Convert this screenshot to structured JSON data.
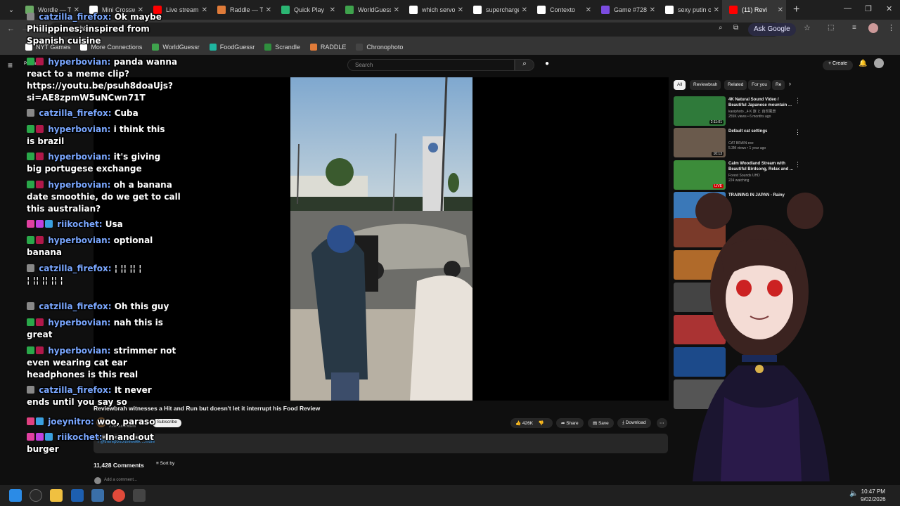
{
  "browser": {
    "tabs": [
      {
        "title": "Wordle — Th",
        "color": "#6aaa64"
      },
      {
        "title": "Mini Crossw",
        "color": "#ffffff"
      },
      {
        "title": "Live stream",
        "color": "#ff0000"
      },
      {
        "title": "Raddle — Th",
        "color": "#e07b39"
      },
      {
        "title": "Quick Play",
        "color": "#2bb673"
      },
      {
        "title": "WorldGuess",
        "color": "#3fa34d"
      },
      {
        "title": "which servo",
        "color": "#ffffff"
      },
      {
        "title": "supercharge",
        "color": "#ffffff"
      },
      {
        "title": "Contexto",
        "color": "#ffffff"
      },
      {
        "title": "Game #728",
        "color": "#7b4ce0"
      },
      {
        "title": "sexy putin c",
        "color": "#ffffff"
      },
      {
        "title": "(11) Revi",
        "color": "#ff0000"
      }
    ],
    "url": "/v=psuh8doaUjs",
    "ask_google": "Ask Google",
    "bookmarks": [
      {
        "label": "NYT Games",
        "color": "#ffffff"
      },
      {
        "label": "More Connections",
        "color": "#ffffff"
      },
      {
        "label": "WorldGuessr",
        "color": "#3fa34d"
      },
      {
        "label": "FoodGuessr",
        "color": "#1fb5a0"
      },
      {
        "label": "Scrandle",
        "color": "#2f8f3e"
      },
      {
        "label": "RADDLE",
        "color": "#e07b39"
      },
      {
        "label": "Chronophoto",
        "color": "#444444"
      }
    ]
  },
  "youtube": {
    "search_placeholder": "Search",
    "create_label": "Create",
    "premium_label": "Premium",
    "video_title": "Reviewbrah witnesses a Hit and Run but doesn't let it interrupt his Food Review",
    "channel_subs": "2.2M subscribers",
    "subscribe_label": "Subscribe",
    "likes": "426K",
    "share_label": "Share",
    "save_label": "Save",
    "download_label": "Download",
    "views_line": "11M views  8 years ago",
    "desc_line": "/ @thereportoftheweek  ...more",
    "comments_count": "11,428 Comments",
    "sort_label": "Sort by",
    "add_comment": "Add a comment...",
    "chips": [
      "All",
      "Reviewbrah",
      "Related",
      "For you",
      "Re"
    ],
    "recommendations": [
      {
        "title": "4K Natural Sound Video / Beautiful Japanese mountain ...",
        "channel": "kaoiphoto _4 K 旅 と 自然風景",
        "meta": "255K views • 6 months ago",
        "duration": "2:11:01",
        "color": "#2f7a3a"
      },
      {
        "title": "Default cat settings",
        "channel": "CAT BRAIN exe",
        "meta": "5.3M views • 1 year ago",
        "duration": "10:13",
        "color": "#6a5a4c"
      },
      {
        "title": "Calm Woodland Stream with Beautiful Birdsong, Relax and ...",
        "channel": "Forest Sounds UHD",
        "meta": "224 watching",
        "duration": "LIVE",
        "color": "#3c8c3a"
      },
      {
        "title": "TRAINING IN JAPAN - Rainy",
        "channel": "",
        "meta": "",
        "duration": "",
        "color": "#3a78b8"
      }
    ]
  },
  "chat": {
    "messages": [
      {
        "user": "catzilla_firefox:",
        "text": "Ok maybe",
        "line2": "Philippines, inspired from",
        "line3": "Spanish cuisine"
      },
      {
        "user": "hyperbovian:",
        "text": "panda wanna",
        "line2": "react to a meme clip?",
        "line3": "https://youtu.be/psuh8doaUjs?",
        "line4": "si=AE8zpmW5uNCwn71T"
      },
      {
        "user": "catzilla_firefox:",
        "text": "Cuba"
      },
      {
        "user": "hyperbovian:",
        "text": "i think this",
        "line2": "is brazil"
      },
      {
        "user": "hyperbovian:",
        "text": "it's giving",
        "line2": "big portugese exchange"
      },
      {
        "user": "hyperbovian:",
        "text": "oh a banana",
        "line2": "date smoothie, do we get to call",
        "line3": "this australian?"
      },
      {
        "user": "riikochet:",
        "text": "Usa"
      },
      {
        "user": "hyperbovian:",
        "text": "optional",
        "line2": "banana"
      },
      {
        "user": "catzilla_firefox:",
        "text": "¦ ¦¦ ¦¦ ¦",
        "line2": "¦ ¦¦ ¦¦ ¦¦ ¦"
      },
      {
        "user": "catzilla_firefox:",
        "text": "Oh this guy"
      },
      {
        "user": "hyperbovian:",
        "text": "nah this is",
        "line2": "great"
      },
      {
        "user": "hyperbovian:",
        "text": "strimmer not",
        "line2": "even wearing cat ear",
        "line3": "headphones is this real"
      },
      {
        "user": "catzilla_firefox:",
        "text": "It never",
        "line2": "ends until you say so"
      },
      {
        "user": "joeynitro:",
        "text": "woo, paraso"
      },
      {
        "user": "riikochet:",
        "text": "In and out",
        "line2": "burger"
      }
    ]
  },
  "system": {
    "time": "10:47 PM",
    "date": "9/02/2026"
  },
  "colors": {
    "chat_user": "#7aa7ff",
    "yt_red": "#ff0000",
    "chrome_bg": "#1f1f1f"
  }
}
